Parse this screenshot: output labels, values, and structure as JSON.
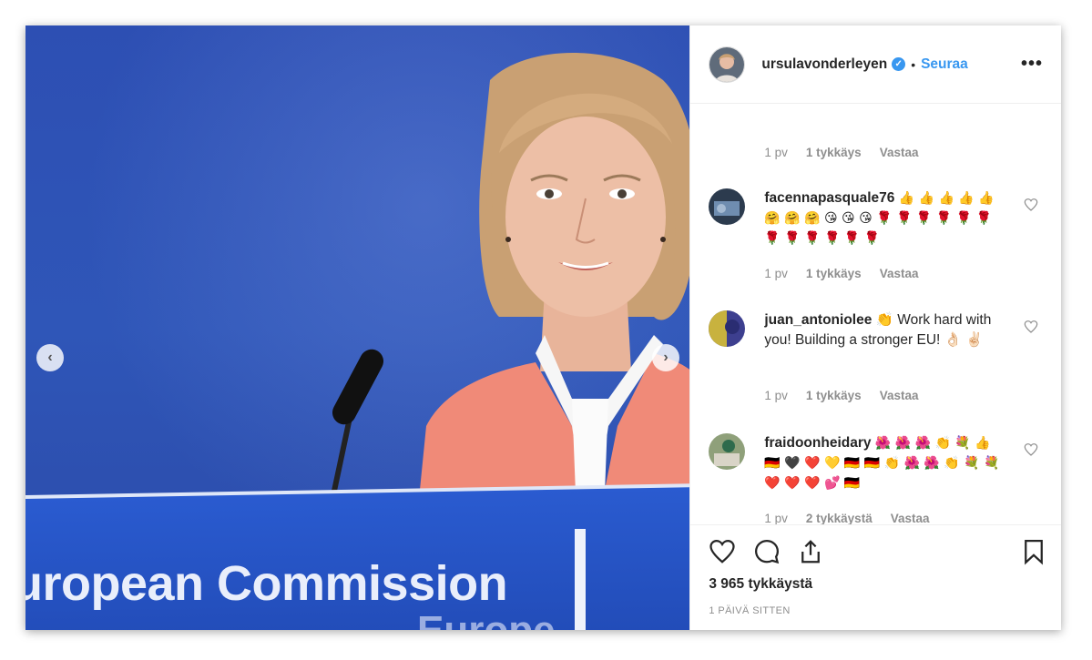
{
  "photo": {
    "podium_text": "uropean Commission",
    "podium_text_2": "Europe"
  },
  "post": {
    "username": "ursulavonderleyen",
    "follow_label": "Seuraa",
    "separator": "•",
    "more_label": "•••"
  },
  "top_meta": {
    "time": "1 pv",
    "likes": "1 tykkäys",
    "reply": "Vastaa"
  },
  "comments": [
    {
      "user": "facennapasquale76",
      "text": "👍 👍 👍 👍 👍 🤗 🤗 🤗 😘 😘 😘 🌹 🌹 🌹 🌹 🌹 🌹 🌹 🌹 🌹 🌹 🌹 🌹",
      "time": "1 pv",
      "likes": "1 tykkäys",
      "reply": "Vastaa"
    },
    {
      "user": "juan_antoniolee",
      "text": "👏 Work hard with you! Building a stronger EU! 👌🏻 ✌🏻",
      "time": "1 pv",
      "likes": "1 tykkäys",
      "reply": "Vastaa"
    },
    {
      "user": "fraidoonheidary",
      "text": "🌺 🌺 🌺 👏 💐 👍 🇩🇪 🖤 ❤️ 💛 🇩🇪 🇩🇪 👏 🌺 🌺 👏 💐 💐 ❤️ ❤️ ❤️ 💕 🇩🇪",
      "time": "1 pv",
      "likes": "2 tykkäystä",
      "reply": "Vastaa"
    }
  ],
  "footer": {
    "likes_count": "3 965 tykkäystä",
    "time_ago": "1 PÄIVÄ SITTEN"
  },
  "colors": {
    "accent": "#3897f0",
    "text": "#262626",
    "muted": "#8e8e8e",
    "photo_blue": "#2d4fb3",
    "blazer": "#f08a78"
  }
}
